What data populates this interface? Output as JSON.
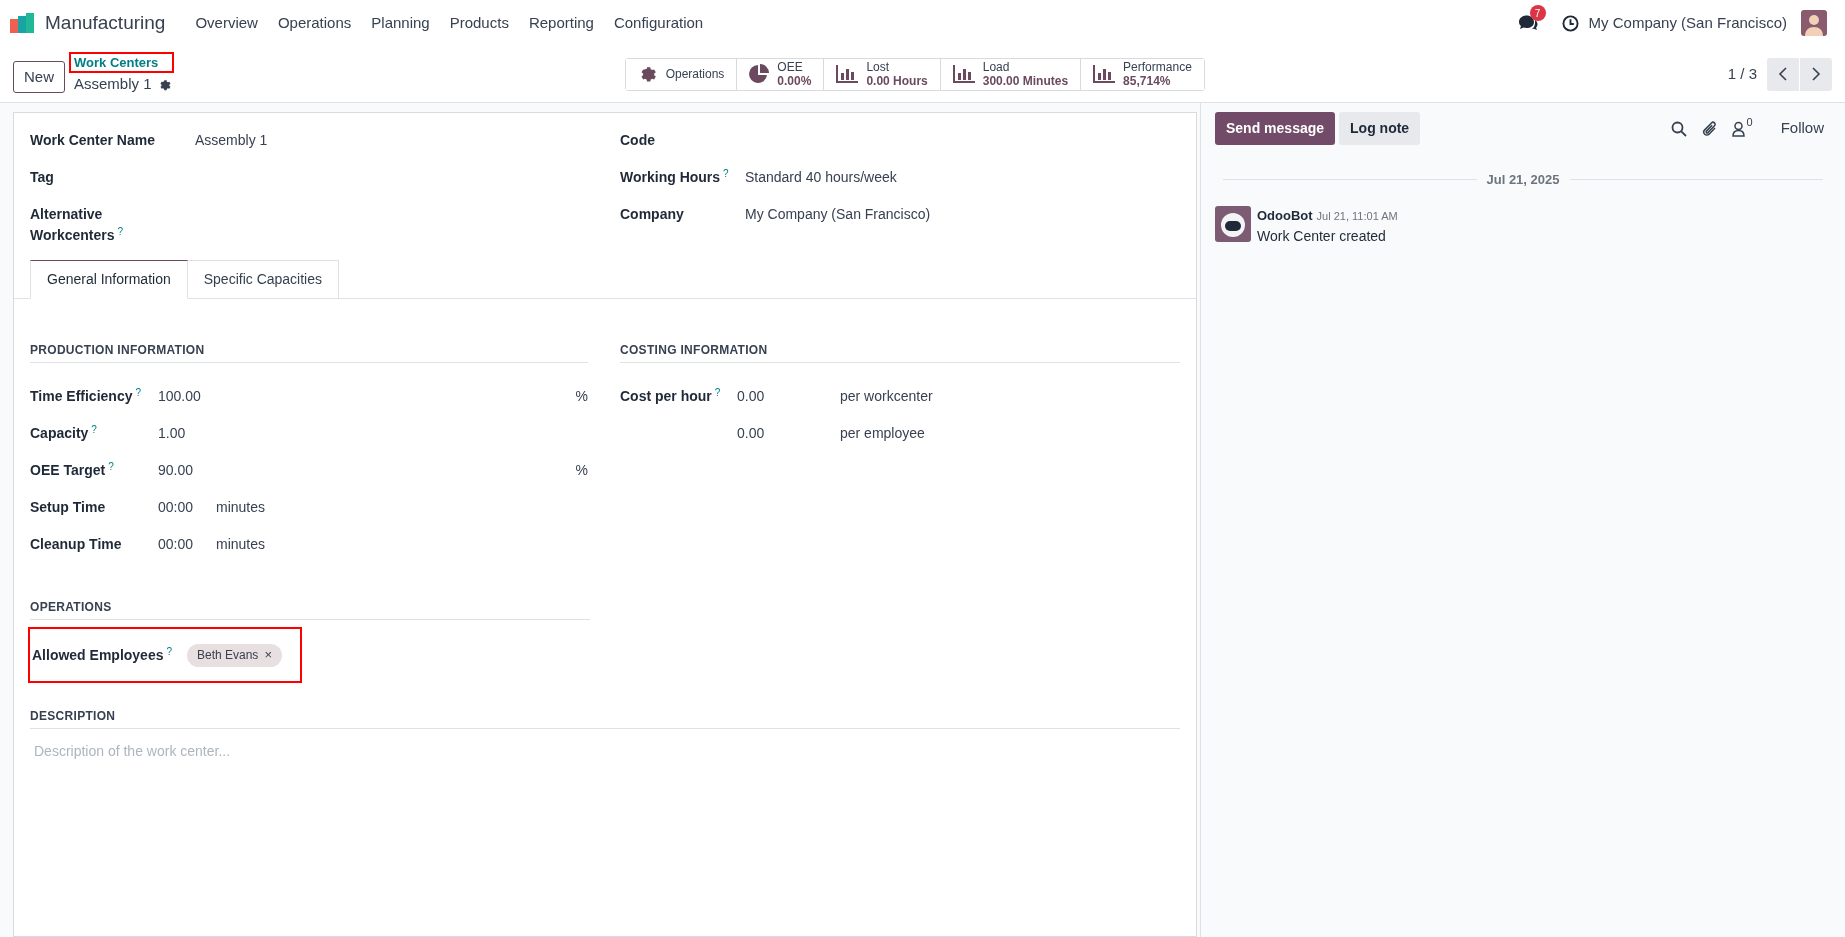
{
  "navbar": {
    "app_name": "Manufacturing",
    "menu": [
      "Overview",
      "Operations",
      "Planning",
      "Products",
      "Reporting",
      "Configuration"
    ],
    "messages_badge": "7",
    "company": "My Company (San Francisco)"
  },
  "control_panel": {
    "new_button": "New",
    "breadcrumb": {
      "parent": "Work Centers",
      "current": "Assembly 1",
      "highlighted": true
    },
    "stat_buttons": [
      {
        "kind": "gear",
        "label": "Operations"
      },
      {
        "kind": "pie",
        "label": "OEE",
        "value": "0.00%"
      },
      {
        "kind": "bars",
        "label": "Lost",
        "value": "0.00 Hours"
      },
      {
        "kind": "bars",
        "label": "Load",
        "value": "300.00 Minutes"
      },
      {
        "kind": "bars",
        "label": "Performance",
        "value": "85,714%"
      }
    ],
    "pager": "1 / 3"
  },
  "form": {
    "fields_left": [
      {
        "label": "Work Center Name",
        "value": "Assembly 1"
      },
      {
        "label": "Tag"
      },
      {
        "label": "Alternative Workcenters",
        "help": "?"
      }
    ],
    "fields_right": [
      {
        "label": "Code"
      },
      {
        "label": "Working Hours",
        "help": "?",
        "value": "Standard 40 hours/week"
      },
      {
        "label": "Company",
        "value": "My Company (San Francisco)"
      }
    ],
    "tabs": [
      {
        "label": "General Information",
        "selected": true
      },
      {
        "label": "Specific Capacities",
        "selected": false
      }
    ],
    "production": {
      "title": "PRODUCTION INFORMATION",
      "rows": [
        {
          "kind": "percent",
          "label": "Time Efficiency",
          "help": "?",
          "value": "100.00",
          "unit": "%"
        },
        {
          "kind": "plain",
          "label": "Capacity",
          "help": "?",
          "value": "1.00"
        },
        {
          "kind": "percent",
          "label": "OEE Target",
          "help": "?",
          "value": "90.00",
          "unit": "%"
        },
        {
          "kind": "duration",
          "label": "Setup Time",
          "value": "00:00",
          "unit": "minutes"
        },
        {
          "kind": "duration",
          "label": "Cleanup Time",
          "value": "00:00",
          "unit": "minutes"
        }
      ]
    },
    "costing": {
      "title": "COSTING INFORMATION",
      "rows": [
        {
          "label": "Cost per hour",
          "help": "?",
          "value": "0.00",
          "unit": "per workcenter"
        },
        {
          "value": "0.00",
          "unit": "per employee"
        }
      ]
    },
    "operations": {
      "title": "OPERATIONS",
      "field": {
        "label": "Allowed Employees",
        "help": "?",
        "tags": [
          {
            "label": "Beth Evans",
            "remove": "×"
          }
        ],
        "highlighted": true
      }
    },
    "description": {
      "title": "DESCRIPTION",
      "placeholder": "Description of the work center..."
    }
  },
  "chatter": {
    "send_button": "Send message",
    "log_button": "Log note",
    "follower_count": "0",
    "follow": "Follow",
    "date": "Jul 21, 2025",
    "messages": [
      {
        "author": "OdooBot",
        "time": "Jul 21, 11:01 AM",
        "body": "Work Center created"
      }
    ]
  }
}
